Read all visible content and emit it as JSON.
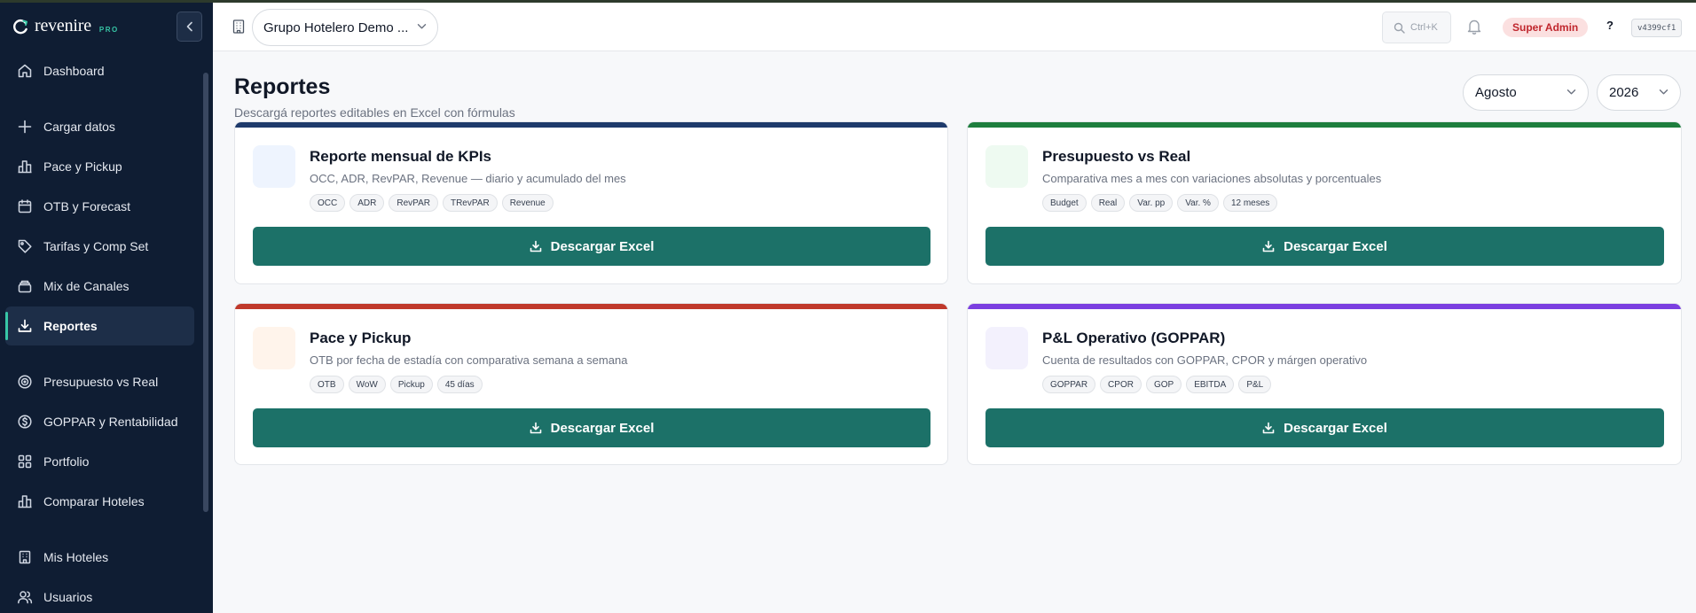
{
  "brand": {
    "name": "revenire",
    "tier": "PRO"
  },
  "sidebar": {
    "items": [
      {
        "label": "Dashboard",
        "icon": "home-icon",
        "active": false
      },
      {
        "label": "Cargar datos",
        "icon": "plus-icon",
        "active": false
      },
      {
        "label": "Pace y Pickup",
        "icon": "bar-chart-icon",
        "active": false
      },
      {
        "label": "OTB y Forecast",
        "icon": "calendar-icon",
        "active": false
      },
      {
        "label": "Tarifas y Comp Set",
        "icon": "tag-icon",
        "active": false
      },
      {
        "label": "Mix de Canales",
        "icon": "stack-icon",
        "active": false
      },
      {
        "label": "Reportes",
        "icon": "download-icon",
        "active": true
      },
      {
        "label": "Presupuesto vs Real",
        "icon": "target-icon",
        "active": false
      },
      {
        "label": "GOPPAR y Rentabilidad",
        "icon": "dollar-circle-icon",
        "active": false
      },
      {
        "label": "Portfolio",
        "icon": "grid-icon",
        "active": false
      },
      {
        "label": "Comparar Hoteles",
        "icon": "bar-chart-icon",
        "active": false
      },
      {
        "label": "Mis Hoteles",
        "icon": "building-icon",
        "active": false
      },
      {
        "label": "Usuarios",
        "icon": "users-icon",
        "active": false
      }
    ]
  },
  "header": {
    "hotel_selector": "Grupo Hotelero Demo ...",
    "search_shortcut": "Ctrl+K",
    "role_badge": "Super Admin",
    "help_label": "?",
    "version": "v4399cf1"
  },
  "page": {
    "title": "Reportes",
    "subtitle": "Descargá reportes editables en Excel con fórmulas",
    "month": "Agosto",
    "year": "2026"
  },
  "reports": [
    {
      "title": "Reporte mensual de KPIs",
      "description": "OCC, ADR, RevPAR, Revenue — diario y acumulado del mes",
      "tags": [
        "OCC",
        "ADR",
        "RevPAR",
        "TRevPAR",
        "Revenue"
      ],
      "button": "Descargar Excel",
      "accent_color": "#1e3a6b",
      "thumb_color": "#eef4fe"
    },
    {
      "title": "Presupuesto vs Real",
      "description": "Comparativa mes a mes con variaciones absolutas y porcentuales",
      "tags": [
        "Budget",
        "Real",
        "Var. pp",
        "Var. %",
        "12 meses"
      ],
      "button": "Descargar Excel",
      "accent_color": "#1e7e3e",
      "thumb_color": "#eefaf1"
    },
    {
      "title": "Pace y Pickup",
      "description": "OTB por fecha de estadía con comparativa semana a semana",
      "tags": [
        "OTB",
        "WoW",
        "Pickup",
        "45 días"
      ],
      "button": "Descargar Excel",
      "accent_color": "#c0392b",
      "thumb_color": "#fff4eb"
    },
    {
      "title": "P&L Operativo (GOPPAR)",
      "description": "Cuenta de resultados con GOPPAR, CPOR y márgen operativo",
      "tags": [
        "GOPPAR",
        "CPOR",
        "GOP",
        "EBITDA",
        "P&L"
      ],
      "button": "Descargar Excel",
      "accent_color": "#7b3fe0",
      "thumb_color": "#f3f1fd"
    }
  ],
  "colors": {
    "sidebar_bg": "#0f1d33",
    "accent": "#37c6a6",
    "button_bg": "#1c7168"
  }
}
